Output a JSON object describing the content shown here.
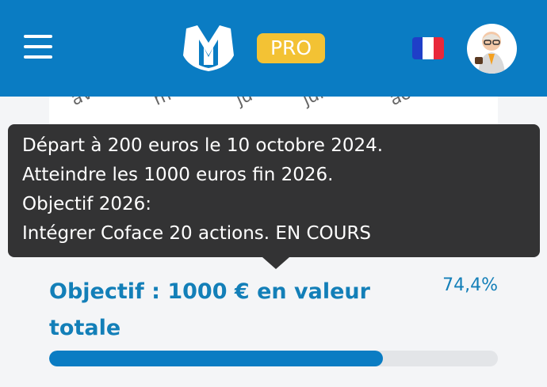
{
  "header": {
    "logo_letter": "M",
    "pro_badge": "PRO",
    "language_flag": "france-flag",
    "colors": {
      "header_bg": "#0a7cc3",
      "badge_bg": "#f3c234"
    }
  },
  "chart_axis": {
    "labels": [
      "av",
      "m",
      "ju",
      "juille",
      "ao"
    ]
  },
  "tooltip": {
    "lines": [
      "Départ à 200 euros le 10 octobre 2024.",
      "Atteindre les 1000 euros fin 2026.",
      "Objectif 2026:",
      "Intégrer Coface 20 actions. EN COURS"
    ]
  },
  "objective": {
    "label": "Objectif : 1000 € en valeur totale",
    "percent": "74,4%",
    "progress": 0.744
  }
}
